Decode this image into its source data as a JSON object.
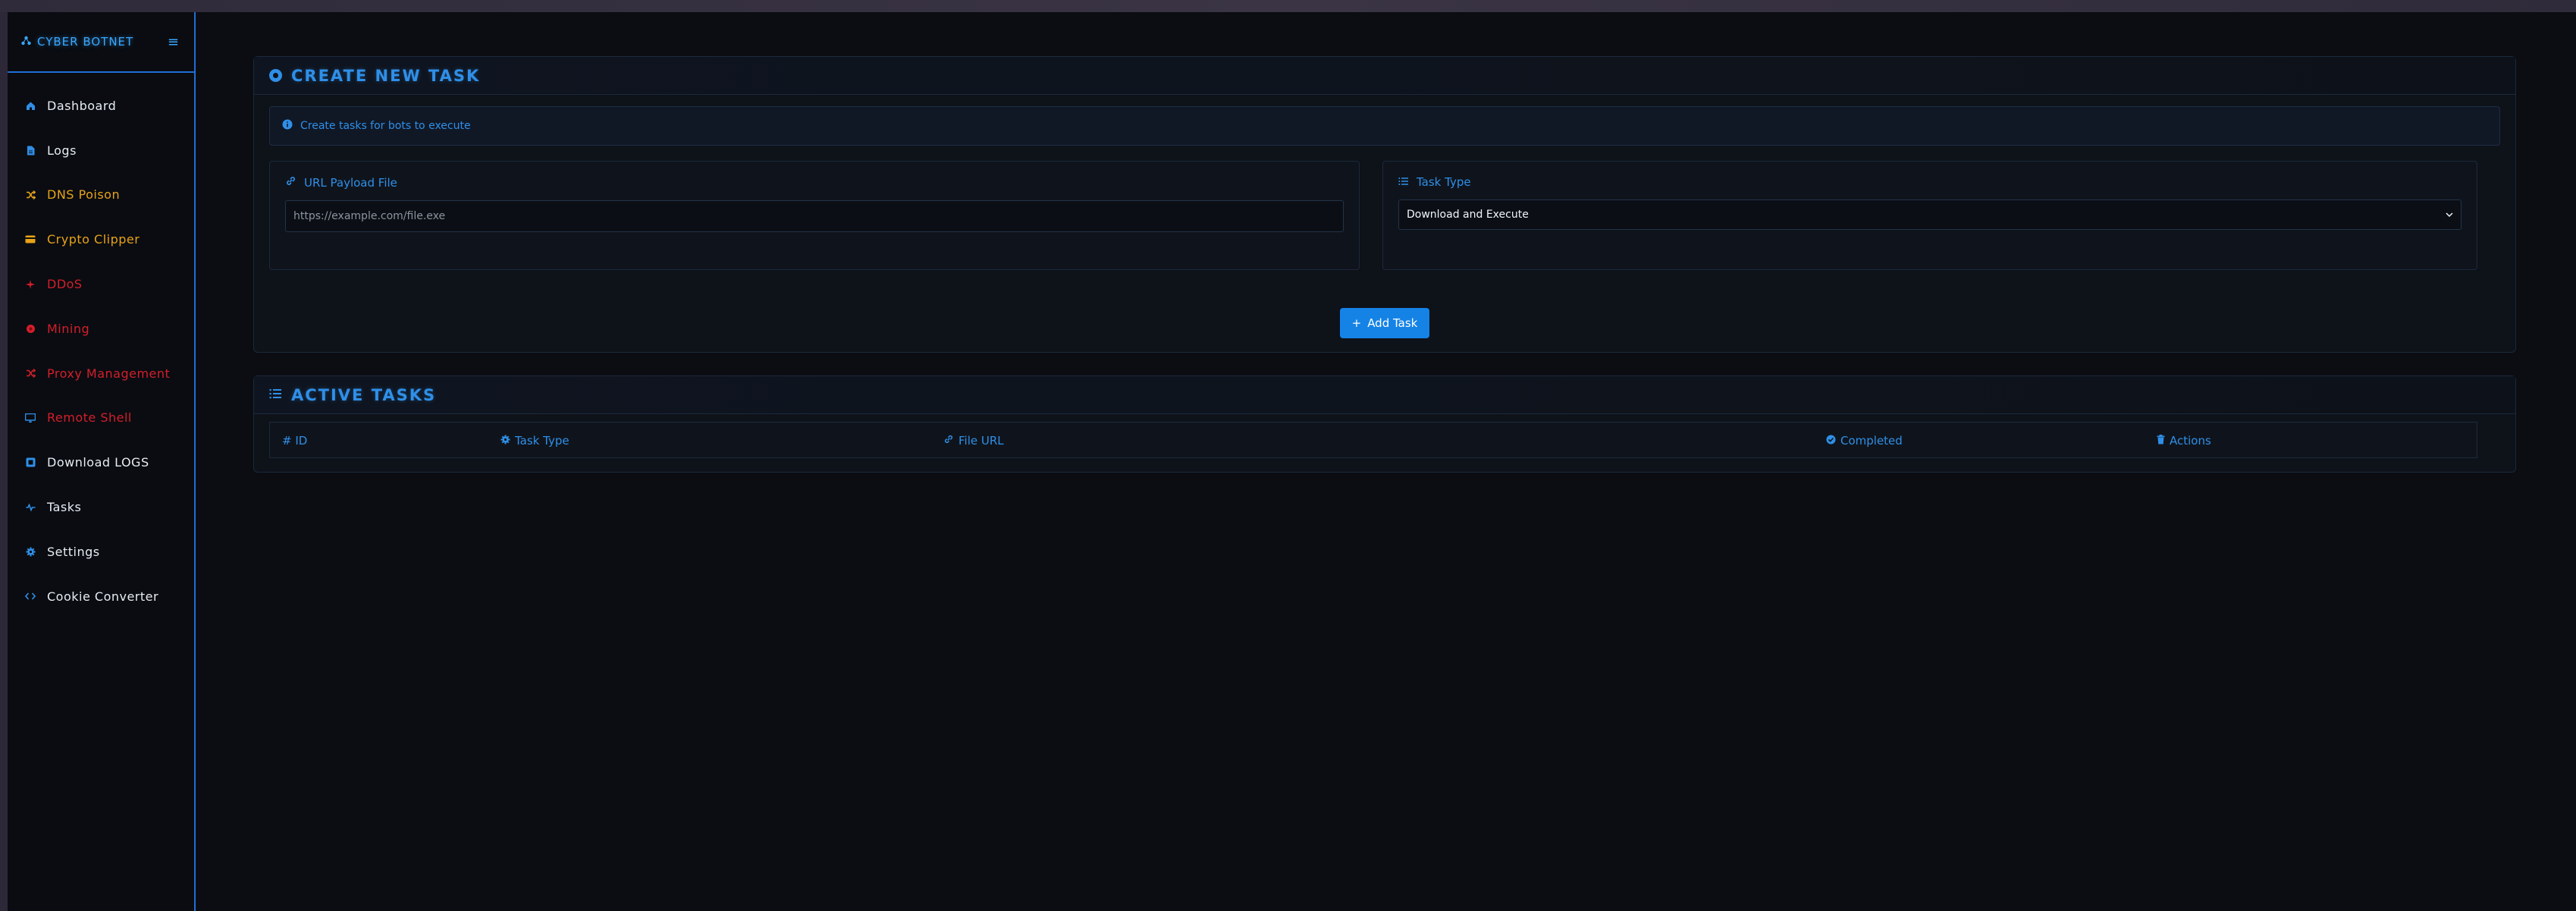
{
  "sidebar": {
    "brand": "CYBER BOTNET",
    "items": [
      {
        "label": "Dashboard",
        "color": "#e6edf3",
        "icon": "home-icon"
      },
      {
        "label": "Logs",
        "color": "#e6edf3",
        "icon": "file-icon"
      },
      {
        "label": "DNS Poison",
        "color": "#e8a317",
        "icon": "shuffle-icon"
      },
      {
        "label": "Crypto Clipper",
        "color": "#e8a317",
        "icon": "credit-card-icon"
      },
      {
        "label": "DDoS",
        "color": "#d41e2b",
        "icon": "burst-icon"
      },
      {
        "label": "Mining",
        "color": "#d41e2b",
        "icon": "chip-icon"
      },
      {
        "label": "Proxy Management",
        "color": "#d41e2b",
        "icon": "network-icon"
      },
      {
        "label": "Remote Shell",
        "color": "#d41e2b",
        "icon": "monitor-icon"
      },
      {
        "label": "Download LOGS",
        "color": "#e6edf3",
        "icon": "download-icon"
      },
      {
        "label": "Tasks",
        "color": "#e6edf3",
        "icon": "activity-icon"
      },
      {
        "label": "Settings",
        "color": "#e6edf3",
        "icon": "gear-icon"
      },
      {
        "label": "Cookie Converter",
        "color": "#e6edf3",
        "icon": "code-icon"
      }
    ]
  },
  "create_task": {
    "title": "CREATE NEW TASK",
    "info": "Create tasks for bots to execute",
    "url_label": "URL Payload File",
    "url_placeholder": "https://example.com/file.exe",
    "type_label": "Task Type",
    "type_selected": "Download and Execute",
    "add_button": "Add Task"
  },
  "active_tasks": {
    "title": "ACTIVE TASKS",
    "columns": [
      "# ID",
      "Task Type",
      "File URL",
      "Completed",
      "Actions"
    ]
  },
  "colors": {
    "accent": "#2f8fe8",
    "brand": "#38a7ff",
    "warning": "#e8a317",
    "danger": "#d41e2b"
  }
}
